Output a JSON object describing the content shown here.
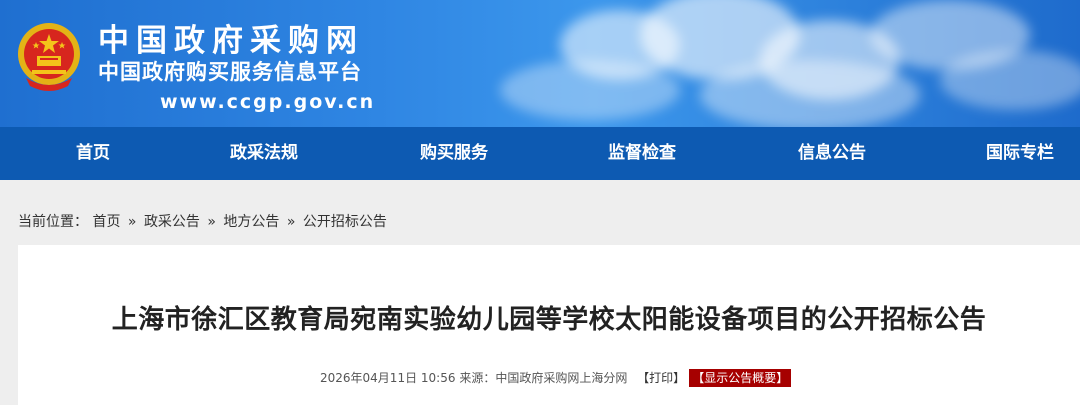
{
  "header": {
    "site_title": "中国政府采购网",
    "site_subtitle": "中国政府购买服务信息平台",
    "site_url": "www.ccgp.gov.cn"
  },
  "nav": {
    "items": [
      {
        "label": "首页"
      },
      {
        "label": "政采法规"
      },
      {
        "label": "购买服务"
      },
      {
        "label": "监督检查"
      },
      {
        "label": "信息公告"
      },
      {
        "label": "国际专栏"
      }
    ]
  },
  "breadcrumb": {
    "prefix": "当前位置：",
    "items": [
      "首页",
      "政采公告",
      "地方公告",
      "公开招标公告"
    ],
    "separator": "»"
  },
  "article": {
    "title": "上海市徐汇区教育局宛南实验幼儿园等学校太阳能设备项目的公开招标公告",
    "datetime": "2026年04月11日 10:56",
    "source_label": "来源：",
    "source": "中国政府采购网上海分网",
    "print_label": "【打印】",
    "summary_label": "【显示公告概要】"
  },
  "colors": {
    "nav_bg": "#0d5ab2",
    "banner_blue": "#2f86e3",
    "summary_badge": "#a60000"
  }
}
